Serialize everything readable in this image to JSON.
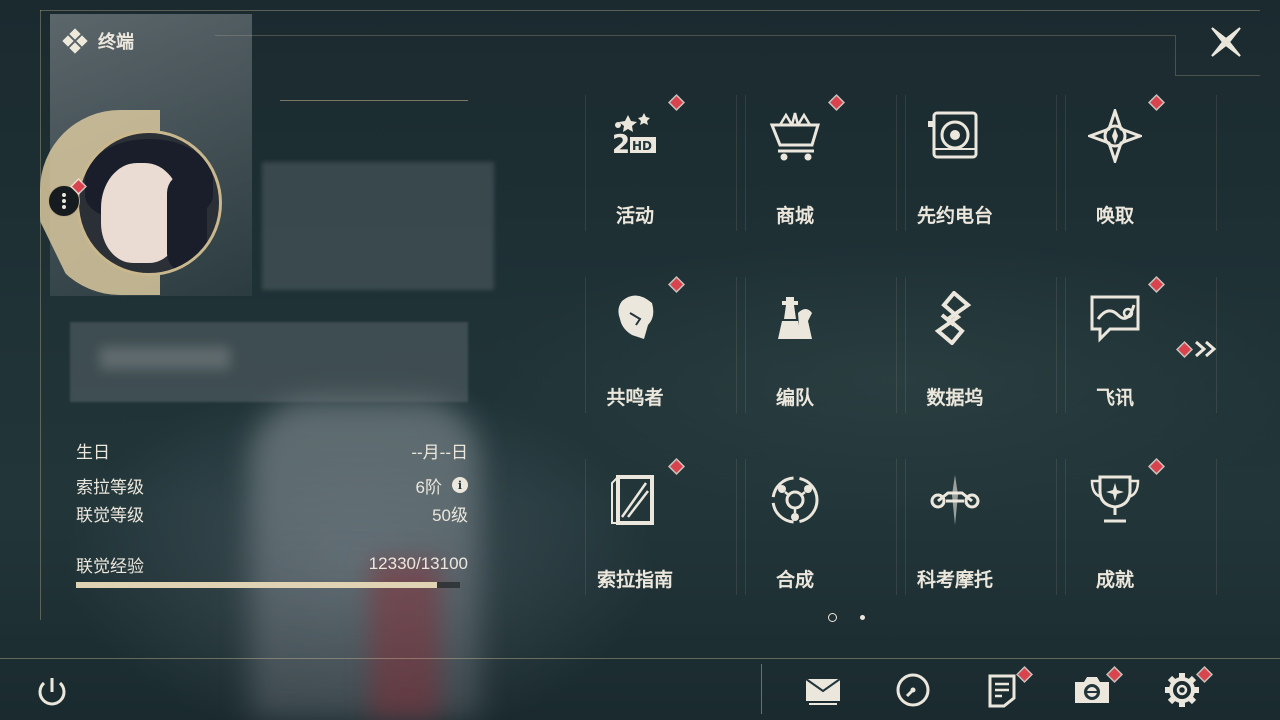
{
  "window": {
    "title": "终端"
  },
  "profile": {
    "birthday_label": "生日",
    "birthday_value": "--月--日",
    "sola_level_label": "索拉等级",
    "sola_level_value": "6阶",
    "union_level_label": "联觉等级",
    "union_level_value": "50级",
    "exp_label": "联觉经验",
    "exp_value": "12330/13100",
    "exp_current": 12330,
    "exp_max": 13100,
    "info_glyph": "i"
  },
  "menu": {
    "items": [
      {
        "label": "活动",
        "icon": "event-2nd-anniversary-icon",
        "badge": true
      },
      {
        "label": "商城",
        "icon": "shop-cart-icon",
        "badge": true
      },
      {
        "label": "先约电台",
        "icon": "radio-icon",
        "badge": false
      },
      {
        "label": "唤取",
        "icon": "convene-star-icon",
        "badge": true
      },
      {
        "label": "共鸣者",
        "icon": "resonator-head-icon",
        "badge": true
      },
      {
        "label": "编队",
        "icon": "chess-team-icon",
        "badge": false
      },
      {
        "label": "数据坞",
        "icon": "data-bank-icon",
        "badge": false
      },
      {
        "label": "飞讯",
        "icon": "chat-message-icon",
        "badge": true
      },
      {
        "label": "索拉指南",
        "icon": "guidebook-icon",
        "badge": true
      },
      {
        "label": "合成",
        "icon": "synthesis-icon",
        "badge": false
      },
      {
        "label": "科考摩托",
        "icon": "motorbike-icon",
        "badge": false
      },
      {
        "label": "成就",
        "icon": "trophy-icon",
        "badge": true
      }
    ],
    "page_current": 1,
    "page_total": 2
  },
  "colors": {
    "badge": "#d9434e",
    "accent": "#d8c79e",
    "text": "#ece7dc"
  }
}
